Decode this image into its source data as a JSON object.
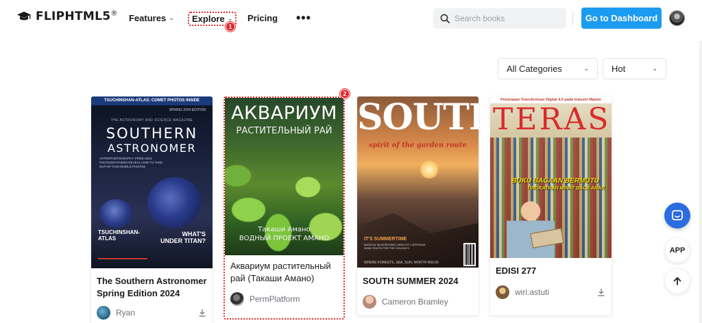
{
  "header": {
    "logo_text": "FLIPHTML5",
    "logo_reg": "®",
    "nav": {
      "features": "Features",
      "explore": "Explore",
      "pricing": "Pricing",
      "more": "•••"
    },
    "search_placeholder": "Search books",
    "dashboard_button": "Go to Dashboard"
  },
  "annotations": [
    "1",
    "2"
  ],
  "filters": {
    "category": "All Categories",
    "sort": "Hot"
  },
  "books": [
    {
      "title": "The Southern Astronomer Spring Edition 2024",
      "owner": "Ryan",
      "cover": {
        "top_banner": "TSUCHINSHAN-ATLAS: COMET PHOTOS INSIDE",
        "edition": "SPRING 2024 EDITION",
        "magazine": "THE ASTRONOMY AND SCIENCE MAGAZINE",
        "title_line1": "SOUTHERN",
        "title_line2": "ASTRONOMER",
        "blurb": "ASTROPHOTOGRAPHY PRIZE 2024: PHOTOGRAPHERS REVEAL HOW TO TAKE OUT-OF-THIS-WORLD PHOTOS",
        "left_head1": "TSUCHINSHAN-",
        "left_head2": "ATLAS",
        "right_head1": "WHAT'S",
        "right_head2": "UNDER TITAN?"
      }
    },
    {
      "title": "Аквариум растительный рай (Такаши Амано)",
      "owner": "PermPlatform",
      "cover": {
        "title_line1": "АКВАРИУМ",
        "title_line2": "РАСТИТЕЛЬНЫЙ РАЙ",
        "author1": "Такаши Амано",
        "author2": "ВОДНЫЙ ПРОЕКТ АМАНО"
      }
    },
    {
      "title": "SOUTH SUMMER 2024",
      "owner": "Cameron Bramley",
      "cover": {
        "title_line1": "SOUTH",
        "reg": "®",
        "tagline": "spirit of the garden route",
        "tag": "IT'S SUMMERTIME",
        "small1": "MAGICAL MUSHROOMS | NEW DIY | HERITAGE",
        "small2": "HEAD SOUTH FOR THE HOLIDAYS",
        "bottom": "WHERE FORESTS, SEA, SUN, WORTH R60.00"
      }
    },
    {
      "title": "EDISI 277",
      "owner": "wiri.astuti",
      "cover": {
        "top_banner": "Penerapan Transformasi Digital 4.0 pada Industri Mamin",
        "title_line1": "TERAS",
        "sub1": "BUKU BACAAN BERMUTU",
        "sub2": "TINGKATKAN MINAT BACA ANAK"
      }
    }
  ],
  "floating": {
    "app_label": "APP"
  },
  "colors": {
    "accent": "#1c9cf0",
    "annotation": "#e0262b",
    "chat": "#2b6ce0"
  }
}
